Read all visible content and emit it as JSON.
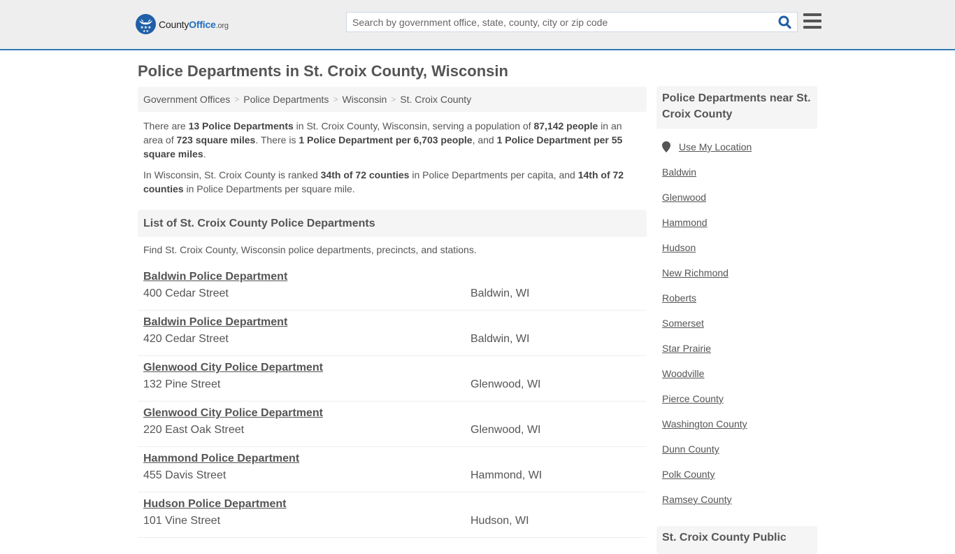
{
  "site": {
    "logo_main": "County",
    "logo_bold": "Office",
    "logo_suffix": ".org",
    "search_placeholder": "Search by government office, state, county, city or zip code",
    "accent_color": "#337ab7"
  },
  "page": {
    "title": "Police Departments in St. Croix County, Wisconsin",
    "breadcrumb": [
      "Government Offices",
      "Police Departments",
      "Wisconsin",
      "St. Croix County"
    ],
    "breadcrumb_separator": ">"
  },
  "intro": {
    "p1": [
      {
        "t": "There are ",
        "b": false
      },
      {
        "t": "13 Police Departments",
        "b": true
      },
      {
        "t": " in St. Croix County, Wisconsin, serving a population of ",
        "b": false
      },
      {
        "t": "87,142 people",
        "b": true
      },
      {
        "t": " in an area of ",
        "b": false
      },
      {
        "t": "723 square miles",
        "b": true
      },
      {
        "t": ". There is ",
        "b": false
      },
      {
        "t": "1 Police Department per 6,703 people",
        "b": true
      },
      {
        "t": ", and ",
        "b": false
      },
      {
        "t": "1 Police Department per 55 square miles",
        "b": true
      },
      {
        "t": ".",
        "b": false
      }
    ],
    "p2": [
      {
        "t": "In Wisconsin, St. Croix County is ranked ",
        "b": false
      },
      {
        "t": "34th of 72 counties",
        "b": true
      },
      {
        "t": " in Police Departments per capita, and ",
        "b": false
      },
      {
        "t": "14th of 72 counties",
        "b": true
      },
      {
        "t": " in Police Departments per square mile.",
        "b": false
      }
    ]
  },
  "list": {
    "heading": "List of St. Croix County Police Departments",
    "subtitle": "Find St. Croix County, Wisconsin police departments, precincts, and stations.",
    "items": [
      {
        "name": "Baldwin Police Department",
        "address": "400 Cedar Street",
        "city": "Baldwin, WI"
      },
      {
        "name": "Baldwin Police Department",
        "address": "420 Cedar Street",
        "city": "Baldwin, WI"
      },
      {
        "name": "Glenwood City Police Department",
        "address": "132 Pine Street",
        "city": "Glenwood, WI"
      },
      {
        "name": "Glenwood City Police Department",
        "address": "220 East Oak Street",
        "city": "Glenwood, WI"
      },
      {
        "name": "Hammond Police Department",
        "address": "455 Davis Street",
        "city": "Hammond, WI"
      },
      {
        "name": "Hudson Police Department",
        "address": "101 Vine Street",
        "city": "Hudson, WI"
      }
    ]
  },
  "sidebar": {
    "heading": "Police Departments near St. Croix County",
    "use_location": "Use My Location",
    "links": [
      "Baldwin",
      "Glenwood",
      "Hammond",
      "Hudson",
      "New Richmond",
      "Roberts",
      "Somerset",
      "Star Prairie",
      "Woodville",
      "Pierce County",
      "Washington County",
      "Dunn County",
      "Polk County",
      "Ramsey County"
    ],
    "heading2": "St. Croix County Public"
  }
}
